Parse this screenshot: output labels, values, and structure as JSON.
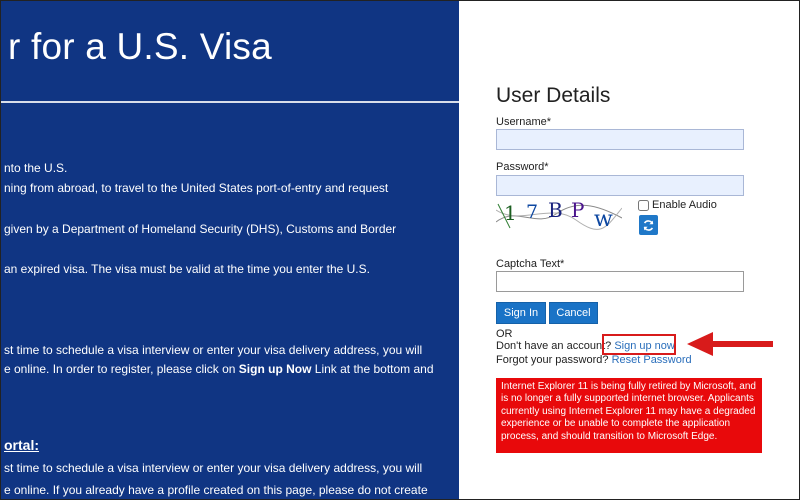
{
  "left": {
    "title": "r for a U.S. Visa",
    "lines": [
      "nto the U.S.",
      "ning from abroad, to travel to the United States port-of-entry and request",
      "given by a Department of Homeland Security (DHS), Customs and Border",
      "an expired visa. The visa must be valid at the time you enter the U.S.",
      "st time to schedule a visa interview or enter your visa delivery address, you will",
      "e online. In order to register, please click on ",
      "st time to schedule a visa interview or enter your visa delivery address, you will",
      "e online. If you already have a profile created on this page, please do not create"
    ],
    "signup_bold": "Sign up Now",
    "signup_tail": " Link at the bottom and",
    "section_heading": "ortal:"
  },
  "form": {
    "title": "User Details",
    "username_label": "Username*",
    "username_value": "",
    "password_label": "Password*",
    "password_value": "",
    "captcha_chars": [
      "1",
      "7",
      "B",
      "P",
      "w"
    ],
    "enable_audio_label": "Enable Audio",
    "captcha_text_label": "Captcha Text*",
    "captcha_text_value": "",
    "sign_in_label": "Sign In",
    "cancel_label": "Cancel",
    "or_label": "OR",
    "no_account_text": "Don't have an account?",
    "sign_up_link": "Sign up now",
    "forgot_text": "Forgot your password?",
    "reset_link": "Reset Password",
    "warning_text": "Internet Explorer 11 is being fully retired by Microsoft, and is no longer a fully supported internet browser. Applicants currently using Internet Explorer 11 may have a degraded experience or be unable to complete the application process, and should transition to Microsoft Edge.",
    "annotation_color": "#d81b1b",
    "warning_color": "#e8090b",
    "button_color": "#1a73c6",
    "panel_color": "#103583"
  },
  "icons": {
    "refresh": "refresh-icon",
    "arrow": "arrow-left-icon"
  }
}
